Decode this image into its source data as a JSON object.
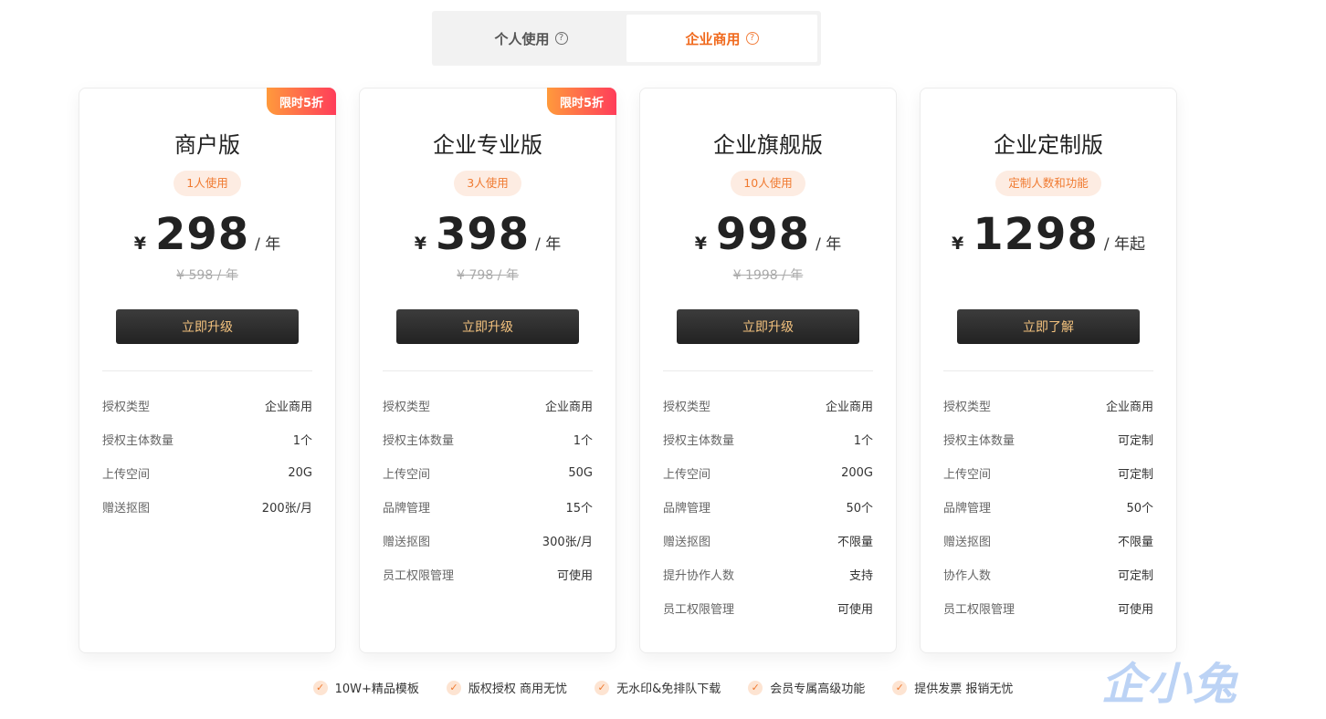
{
  "tabs": [
    {
      "label": "个人使用",
      "icon": "question-icon"
    },
    {
      "label": "企业商用",
      "icon": "question-icon"
    }
  ],
  "accent_color": "#f06a1e",
  "plans": [
    {
      "badge": "限时5折",
      "title": "商户版",
      "pill": "1人使用",
      "currency": "¥",
      "price": "298",
      "unit": "/ 年",
      "original": "¥ 598 / 年",
      "button": "立即升级",
      "features": [
        {
          "k": "授权类型",
          "v": "企业商用"
        },
        {
          "k": "授权主体数量",
          "v": "1个"
        },
        {
          "k": "上传空间",
          "v": "20G"
        },
        {
          "k": "赠送抠图",
          "v": "200张/月"
        }
      ]
    },
    {
      "badge": "限时5折",
      "title": "企业专业版",
      "pill": "3人使用",
      "currency": "¥",
      "price": "398",
      "unit": "/ 年",
      "original": "¥ 798 / 年",
      "button": "立即升级",
      "features": [
        {
          "k": "授权类型",
          "v": "企业商用"
        },
        {
          "k": "授权主体数量",
          "v": "1个"
        },
        {
          "k": "上传空间",
          "v": "50G"
        },
        {
          "k": "品牌管理",
          "v": "15个"
        },
        {
          "k": "赠送抠图",
          "v": "300张/月"
        },
        {
          "k": "员工权限管理",
          "v": "可使用"
        }
      ]
    },
    {
      "badge": "",
      "title": "企业旗舰版",
      "pill": "10人使用",
      "currency": "¥",
      "price": "998",
      "unit": "/ 年",
      "original": "¥ 1998 / 年",
      "button": "立即升级",
      "features": [
        {
          "k": "授权类型",
          "v": "企业商用"
        },
        {
          "k": "授权主体数量",
          "v": "1个"
        },
        {
          "k": "上传空间",
          "v": "200G"
        },
        {
          "k": "品牌管理",
          "v": "50个"
        },
        {
          "k": "赠送抠图",
          "v": "不限量"
        },
        {
          "k": "提升协作人数",
          "v": "支持"
        },
        {
          "k": "员工权限管理",
          "v": "可使用"
        }
      ]
    },
    {
      "badge": "",
      "title": "企业定制版",
      "pill": "定制人数和功能",
      "currency": "¥",
      "price": "1298",
      "unit": "/ 年起",
      "original": "",
      "button": "立即了解",
      "features": [
        {
          "k": "授权类型",
          "v": "企业商用"
        },
        {
          "k": "授权主体数量",
          "v": "可定制"
        },
        {
          "k": "上传空间",
          "v": "可定制"
        },
        {
          "k": "品牌管理",
          "v": "50个"
        },
        {
          "k": "赠送抠图",
          "v": "不限量"
        },
        {
          "k": "协作人数",
          "v": "可定制"
        },
        {
          "k": "员工权限管理",
          "v": "可使用"
        }
      ]
    }
  ],
  "perks": [
    "10W+精品模板",
    "版权授权 商用无忧",
    "无水印&免排队下载",
    "会员专属高级功能",
    "提供发票 报销无忧"
  ],
  "watermark": "企小兔"
}
